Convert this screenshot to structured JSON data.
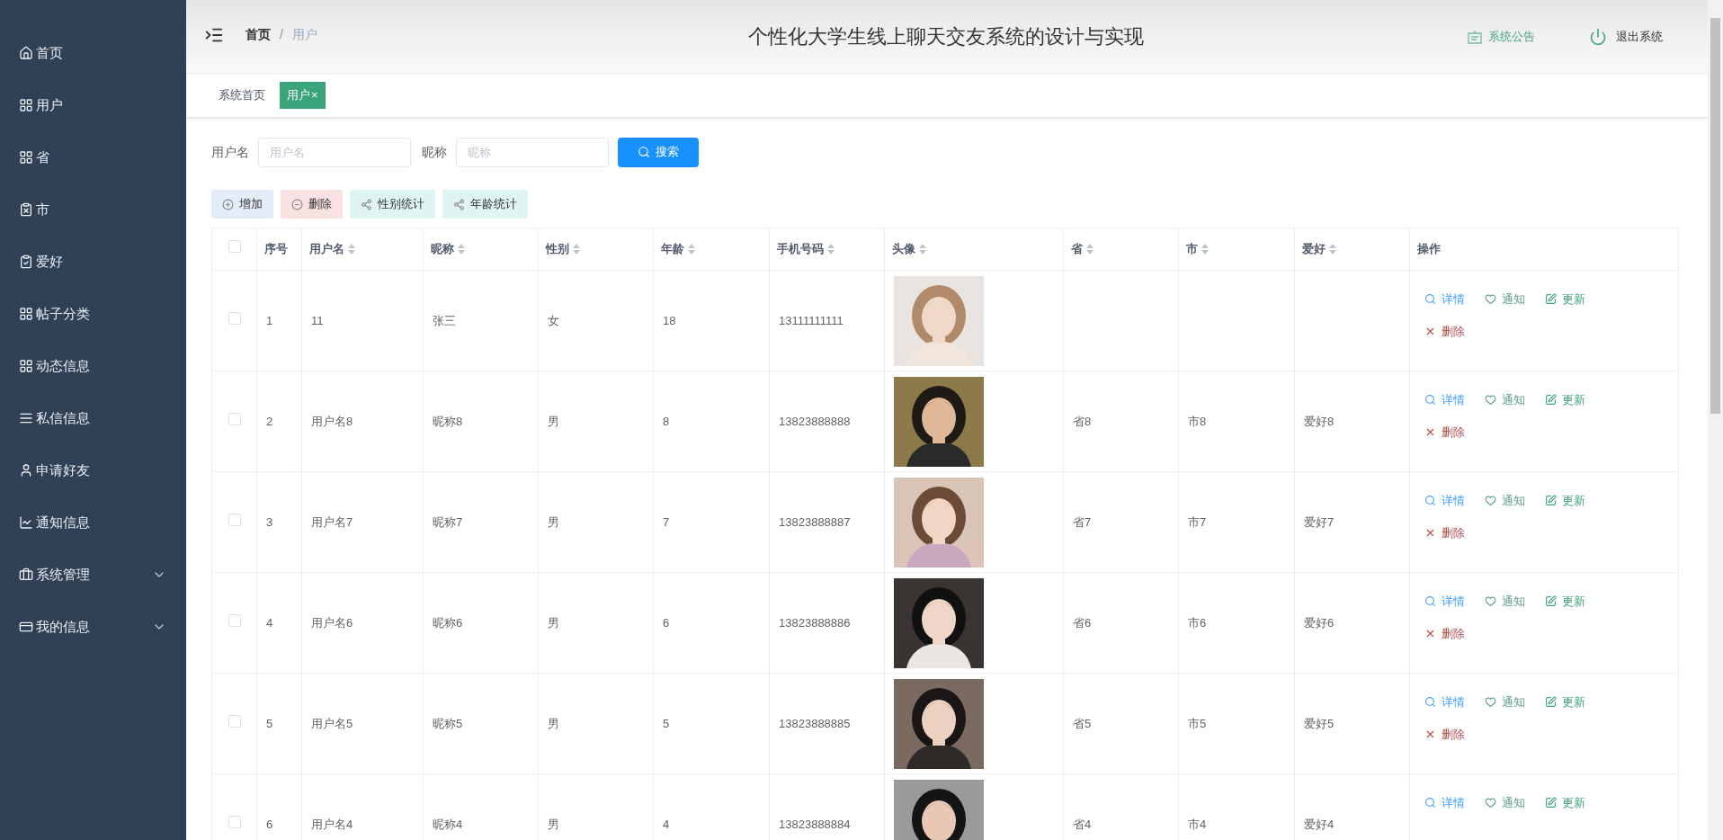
{
  "sidebar": {
    "items": [
      {
        "label": "首页",
        "expandable": false
      },
      {
        "label": "用户",
        "expandable": false
      },
      {
        "label": "省",
        "expandable": false
      },
      {
        "label": "市",
        "expandable": false
      },
      {
        "label": "爱好",
        "expandable": false
      },
      {
        "label": "帖子分类",
        "expandable": false
      },
      {
        "label": "动态信息",
        "expandable": false
      },
      {
        "label": "私信信息",
        "expandable": false
      },
      {
        "label": "申请好友",
        "expandable": false
      },
      {
        "label": "通知信息",
        "expandable": false
      },
      {
        "label": "系统管理",
        "expandable": true
      },
      {
        "label": "我的信息",
        "expandable": true
      }
    ]
  },
  "header": {
    "breadcrumb": [
      {
        "label": "首页",
        "current": false
      },
      {
        "label": "用户",
        "current": true
      }
    ],
    "separator": "/",
    "title": "个性化大学生线上聊天交友系统的设计与实现",
    "notice": "系统公告",
    "logout": "退出系统"
  },
  "tabs": [
    {
      "label": "系统首页",
      "selected": false,
      "closable": false
    },
    {
      "label": "用户",
      "selected": true,
      "closable": true,
      "close": "×"
    }
  ],
  "search": {
    "fields": [
      {
        "label": "用户名",
        "placeholder": "用户名"
      },
      {
        "label": "昵称",
        "placeholder": "昵称"
      }
    ],
    "button": "搜索"
  },
  "toolbar": [
    {
      "label": "增加",
      "kind": "add"
    },
    {
      "label": "删除",
      "kind": "delete"
    },
    {
      "label": "性别统计",
      "kind": "stats"
    },
    {
      "label": "年龄统计",
      "kind": "stats"
    }
  ],
  "table": {
    "header_checked": false,
    "columns": [
      {
        "label": "序号",
        "sortable": false
      },
      {
        "label": "用户名",
        "sortable": true
      },
      {
        "label": "昵称",
        "sortable": true
      },
      {
        "label": "性别",
        "sortable": true
      },
      {
        "label": "年龄",
        "sortable": true
      },
      {
        "label": "手机号码",
        "sortable": true
      },
      {
        "label": "头像",
        "sortable": true
      },
      {
        "label": "省",
        "sortable": true
      },
      {
        "label": "市",
        "sortable": true
      },
      {
        "label": "爱好",
        "sortable": true
      },
      {
        "label": "操作",
        "sortable": false
      }
    ],
    "rows": [
      {
        "checked": false,
        "index": "1",
        "username": "11",
        "nickname": "张三",
        "gender": "女",
        "age": "18",
        "phone": "13111111111",
        "avatar": {
          "kind": "picture"
        },
        "actions": [
          {
            "label": "详情",
            "kind": "detail"
          },
          {
            "label": "通知",
            "kind": "notify"
          },
          {
            "label": "更新",
            "kind": "update"
          },
          {
            "label": "删除",
            "kind": "delete"
          }
        ]
      },
      {
        "checked": false,
        "index": "2",
        "username": "用户名8",
        "nickname": "昵称8",
        "gender": "男",
        "age": "8",
        "phone": "13823888888",
        "avatar": {
          "kind": "picture"
        },
        "province": "省8",
        "city": "市8",
        "hobby": "爱好8",
        "actions": [
          {
            "label": "详情",
            "kind": "detail"
          },
          {
            "label": "通知",
            "kind": "notify"
          },
          {
            "label": "更新",
            "kind": "update"
          },
          {
            "label": "删除",
            "kind": "delete"
          }
        ]
      },
      {
        "checked": false,
        "index": "3",
        "username": "用户名7",
        "nickname": "昵称7",
        "gender": "男",
        "age": "7",
        "phone": "13823888887",
        "avatar": {
          "kind": "picture"
        },
        "province": "省7",
        "city": "市7",
        "hobby": "爱好7",
        "actions": [
          {
            "label": "详情",
            "kind": "detail"
          },
          {
            "label": "通知",
            "kind": "notify"
          },
          {
            "label": "更新",
            "kind": "update"
          },
          {
            "label": "删除",
            "kind": "delete"
          }
        ]
      },
      {
        "checked": false,
        "index": "4",
        "username": "用户名6",
        "nickname": "昵称6",
        "gender": "男",
        "age": "6",
        "phone": "13823888886",
        "avatar": {
          "kind": "picture"
        },
        "province": "省6",
        "city": "市6",
        "hobby": "爱好6",
        "actions": [
          {
            "label": "详情",
            "kind": "detail"
          },
          {
            "label": "通知",
            "kind": "notify"
          },
          {
            "label": "更新",
            "kind": "update"
          },
          {
            "label": "删除",
            "kind": "delete"
          }
        ]
      },
      {
        "checked": false,
        "index": "5",
        "username": "用户名5",
        "nickname": "昵称5",
        "gender": "男",
        "age": "5",
        "phone": "13823888885",
        "avatar": {
          "kind": "picture"
        },
        "province": "省5",
        "city": "市5",
        "hobby": "爱好5",
        "actions": [
          {
            "label": "详情",
            "kind": "detail"
          },
          {
            "label": "通知",
            "kind": "notify"
          },
          {
            "label": "更新",
            "kind": "update"
          },
          {
            "label": "删除",
            "kind": "delete"
          }
        ]
      },
      {
        "checked": false,
        "index": "6",
        "username": "用户名4",
        "nickname": "昵称4",
        "gender": "男",
        "age": "4",
        "phone": "13823888884",
        "avatar": {
          "kind": "picture"
        },
        "province": "省4",
        "city": "市4",
        "hobby": "爱好4",
        "actions": [
          {
            "label": "详情",
            "kind": "detail"
          },
          {
            "label": "通知",
            "kind": "notify"
          },
          {
            "label": "更新",
            "kind": "update"
          }
        ]
      }
    ]
  }
}
